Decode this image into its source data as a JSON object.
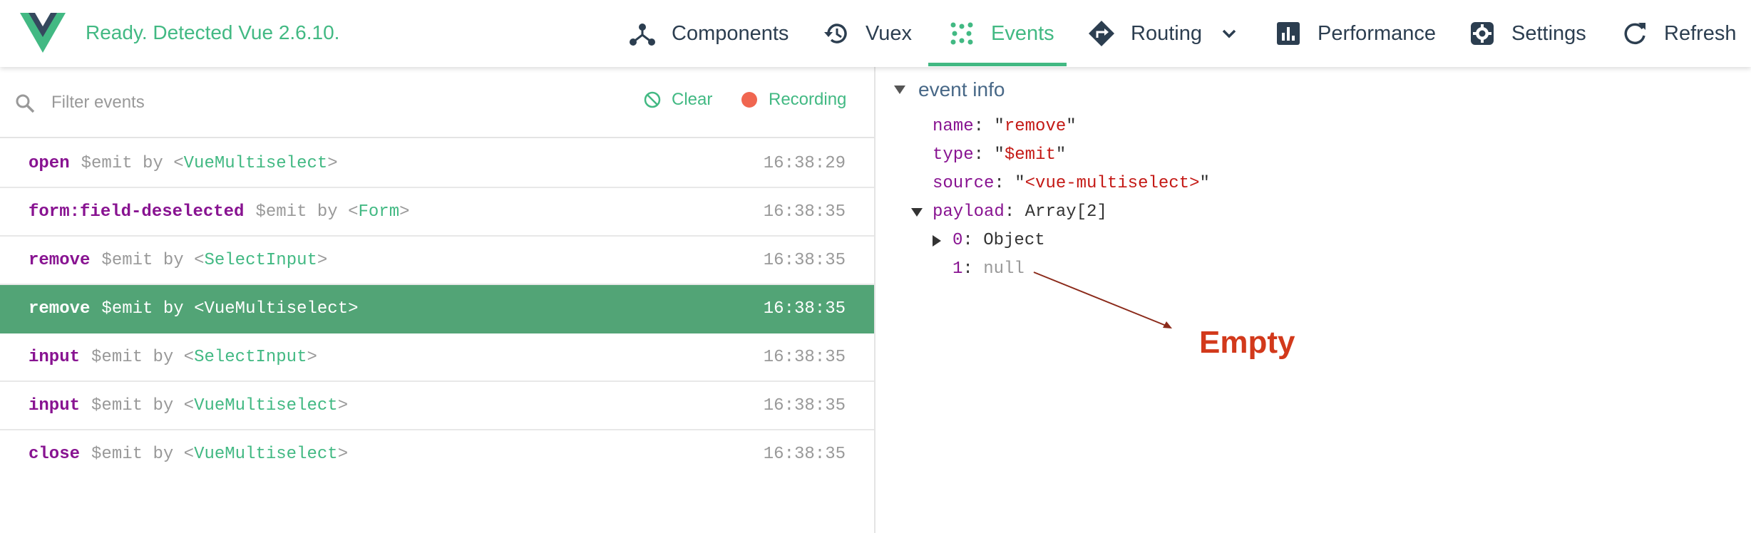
{
  "header": {
    "status": "Ready. Detected Vue 2.6.10.",
    "nav": [
      {
        "label": "Components",
        "icon": "components-icon"
      },
      {
        "label": "Vuex",
        "icon": "history-icon"
      },
      {
        "label": "Events",
        "icon": "events-icon",
        "active": true
      },
      {
        "label": "Routing",
        "icon": "routing-icon"
      },
      {
        "label": "Performance",
        "icon": "performance-icon"
      },
      {
        "label": "Settings",
        "icon": "settings-icon"
      },
      {
        "label": "Refresh",
        "icon": "refresh-icon"
      }
    ]
  },
  "toolbar": {
    "filter_placeholder": "Filter events",
    "clear_label": "Clear",
    "recording_label": "Recording"
  },
  "events": [
    {
      "name": "open",
      "type": "$emit",
      "by": "by",
      "component": "VueMultiselect",
      "time": "16:38:29"
    },
    {
      "name": "form:field-deselected",
      "type": "$emit",
      "by": "by",
      "component": "Form",
      "time": "16:38:35"
    },
    {
      "name": "remove",
      "type": "$emit",
      "by": "by",
      "component": "SelectInput",
      "time": "16:38:35"
    },
    {
      "name": "remove",
      "type": "$emit",
      "by": "by",
      "component": "VueMultiselect",
      "time": "16:38:35",
      "selected": true
    },
    {
      "name": "input",
      "type": "$emit",
      "by": "by",
      "component": "SelectInput",
      "time": "16:38:35"
    },
    {
      "name": "input",
      "type": "$emit",
      "by": "by",
      "component": "VueMultiselect",
      "time": "16:38:35"
    },
    {
      "name": "close",
      "type": "$emit",
      "by": "by",
      "component": "VueMultiselect",
      "time": "16:38:35"
    }
  ],
  "event_info": {
    "title": "event info",
    "name_key": "name",
    "name_val": "remove",
    "type_key": "type",
    "type_val": "$emit",
    "source_key": "source",
    "source_val": "<vue-multiselect>",
    "payload_key": "payload",
    "payload_val": "Array[2]",
    "item0_key": "0",
    "item0_val": "Object",
    "item1_key": "1",
    "item1_val": "null"
  },
  "annotation": {
    "text": "Empty",
    "color": "#d2391b"
  },
  "colors": {
    "accent": "#42b983",
    "selected_row": "#52a476",
    "recording": "#f06650"
  }
}
